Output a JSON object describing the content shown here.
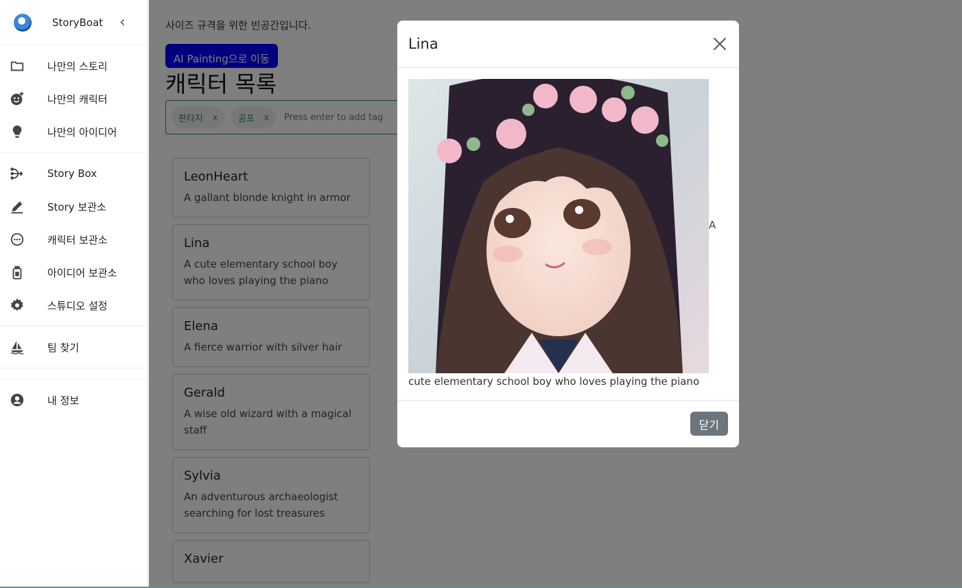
{
  "sidebar": {
    "brand": "StoryBoat",
    "groups": [
      [
        {
          "label": "나만의 스토리",
          "icon": "folder-icon"
        },
        {
          "label": "나만의 캐릭터",
          "icon": "face-add-icon"
        },
        {
          "label": "나만의 아이디어",
          "icon": "lightbulb-icon"
        }
      ],
      [
        {
          "label": "Story Box",
          "icon": "branch-icon"
        },
        {
          "label": "Story 보관소",
          "icon": "pen-icon"
        },
        {
          "label": "캐릭터 보관소",
          "icon": "dots-circle-icon"
        },
        {
          "label": "아이디어 보관소",
          "icon": "jar-icon"
        },
        {
          "label": "스튜디오 설정",
          "icon": "gear-icon"
        }
      ],
      [
        {
          "label": "팀 찾기",
          "icon": "sailboat-icon"
        }
      ],
      [
        {
          "label": "내 정보",
          "icon": "account-icon"
        }
      ]
    ]
  },
  "main": {
    "note": "사이즈 규격을 위한 빈공간입니다.",
    "ai_button": "AI Painting으로 이동",
    "title": "캐릭터 목록",
    "tags": [
      "판타지",
      "공포"
    ],
    "tag_remove": "x",
    "tag_placeholder": "Press enter to add tag",
    "characters": [
      {
        "name": "LeonHeart",
        "desc": "A gallant blonde knight in armor"
      },
      {
        "name": "Lina",
        "desc": "A cute elementary school boy who loves playing the piano"
      },
      {
        "name": "Elena",
        "desc": "A fierce warrior with silver hair"
      },
      {
        "name": "Gerald",
        "desc": "A wise old wizard with a magical staff"
      },
      {
        "name": "Sylvia",
        "desc": "An adventurous archaeologist searching for lost treasures"
      },
      {
        "name": "Xavier",
        "desc": ""
      }
    ]
  },
  "modal": {
    "title": "Lina",
    "image_alt_fragment": "A",
    "description": "cute elementary school boy who loves playing the piano",
    "close_button": "닫기"
  }
}
